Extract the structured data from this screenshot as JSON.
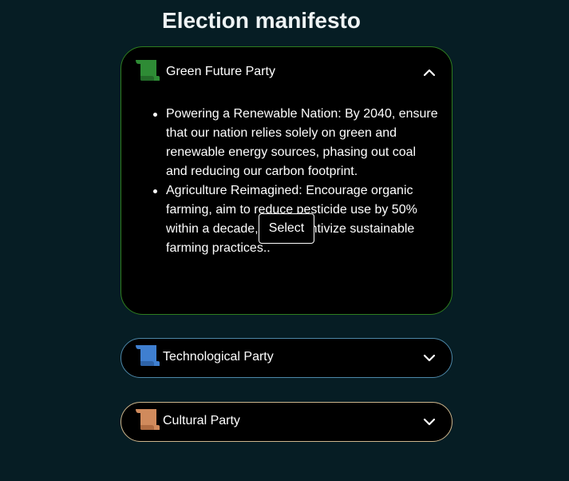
{
  "page": {
    "title": "Election manifesto"
  },
  "parties": [
    {
      "name": "Green Future Party",
      "icon": "scroll-icon",
      "icon_color": "#2e8b35",
      "border_color": "#2e7d1f",
      "expanded": true,
      "manifesto": [
        "Powering a Renewable Nation: By 2040, ensure that our nation relies solely on green and renewable energy sources, phasing out coal and reducing our carbon footprint.",
        "Agriculture Reimagined: Encourage organic farming, aim to reduce pesticide use by 50% within a decade, and incentivize sustainable farming practices.."
      ],
      "select_label": "Select"
    },
    {
      "name": "Technological Party",
      "icon": "scroll-icon",
      "icon_color": "#3f7fd0",
      "border_color": "#4d87a8",
      "expanded": false
    },
    {
      "name": "Cultural Party",
      "icon": "scroll-icon",
      "icon_color": "#d08a5c",
      "border_color": "#cdb58c",
      "expanded": false
    }
  ]
}
